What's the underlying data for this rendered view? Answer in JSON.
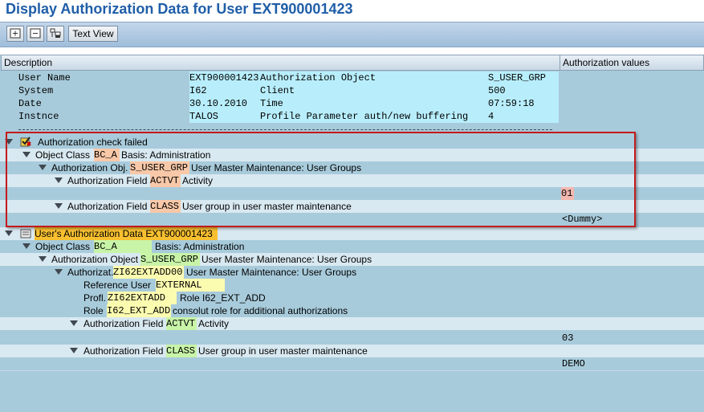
{
  "title": "Display Authorization Data for User EXT900001423",
  "toolbar": {
    "text_view": "Text View",
    "icons": [
      "expand-all-icon",
      "collapse-icon",
      "hierarchy-icon"
    ]
  },
  "columns": {
    "description": "Description",
    "auth_values": "Authorization values"
  },
  "header_block": {
    "user_name_label": "User Name",
    "user_name": "EXT900001423",
    "auth_object_label": "Authorization Object",
    "auth_object": "S_USER_GRP",
    "system_label": "System",
    "system": "I62",
    "client_label": "Client",
    "client": "500",
    "date_label": "Date",
    "date": "30.10.2010",
    "time_label": "Time",
    "time": "07:59:18",
    "instance_label": "Instnce",
    "instance": "TALOS",
    "profile_param_label": "Profile Parameter auth/new buffering",
    "profile_param": "4",
    "separator": "------------------------------------------------------------------------------------------------"
  },
  "failed": {
    "heading": "Authorization check failed",
    "object_class_label": "Object Class",
    "object_class": "BC_A",
    "object_class_desc": "Basis: Administration",
    "auth_obj_label": "Authorization Obj.",
    "auth_obj": "S_USER_GRP",
    "auth_obj_desc": "User Master Maintenance: User Groups",
    "field1_label": "Authorization Field",
    "field1": "ACTVT",
    "field1_desc": "Activity",
    "field1_value": "01",
    "field2_label": "Authorization Field",
    "field2": "CLASS",
    "field2_desc": "User group in user master maintenance",
    "field2_value": "<Dummy>"
  },
  "user_data": {
    "heading": "User's Authorization Data EXT900001423",
    "object_class_label": "Object Class",
    "object_class": "BC_A",
    "object_class_desc": "Basis: Administration",
    "auth_object_label": "Authorization Object",
    "auth_object": "S_USER_GRP",
    "auth_object_desc": "User Master Maintenance: User Groups",
    "authorizat_label": "Authorizat.",
    "authorizat": "ZI62EXTADD00",
    "authorizat_desc": "User Master Maintenance: User Groups",
    "ref_user_label": "Reference User",
    "ref_user": "EXTERNAL",
    "profl_label": "Profl.",
    "profl": "ZI62EXTADD",
    "profl_role": "Role I62_EXT_ADD",
    "role_label": "Role",
    "role": "I62_EXT_ADD",
    "role_desc": "consolut role for additional authorizations",
    "field1_label": "Authorization Field",
    "field1": "ACTVT",
    "field1_desc": "Activity",
    "field1_value": "03",
    "field2_label": "Authorization Field",
    "field2": "CLASS",
    "field2_desc": "User group in user master maintenance",
    "field2_value": "DEMO"
  },
  "colors": {
    "title": "#1f5ea8",
    "background": "#a8cbdb",
    "alt_row": "#d9e9f1",
    "highlight_box": "#c41a1a"
  }
}
